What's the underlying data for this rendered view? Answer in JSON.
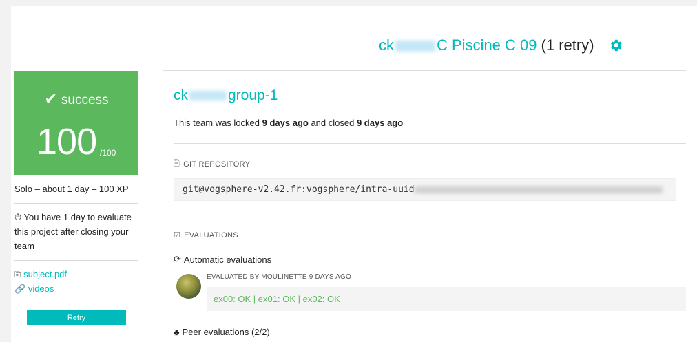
{
  "header": {
    "login_prefix": "ck",
    "project_name": "C Piscine C 09",
    "retry_text": "(1 retry)",
    "settings_icon": "gear-icon",
    "accent_color": "#00babc"
  },
  "score": {
    "status": "success",
    "mark": "100",
    "max": "/100",
    "color": "#5cb85c"
  },
  "sidebar": {
    "project_info": "Solo – about 1 day – 100 XP",
    "evaluation_note": "You have 1 day to evaluate this project after closing your team",
    "links": [
      {
        "label": "subject.pdf",
        "icon": "file-icon"
      },
      {
        "label": "videos",
        "icon": "link-icon"
      }
    ],
    "retry_button": "Retry"
  },
  "team": {
    "name_prefix": "ck",
    "name_suffix": "group-1",
    "lock_text_1": "This team was locked",
    "locked_ago": "9 days ago",
    "lock_text_2": "and closed",
    "closed_ago": "9 days ago"
  },
  "repository": {
    "label": "GIT REPOSITORY",
    "url": "git@vogsphere-v2.42.fr:vogsphere/intra-uuid"
  },
  "evaluations": {
    "label": "EVALUATIONS",
    "automatic_label": "Automatic evaluations",
    "evaluated_by": "EVALUATED BY MOULINETTE 9 DAYS AGO",
    "result": "ex00: OK | ex01: OK | ex02: OK",
    "peer_label": "Peer evaluations (2/2)"
  }
}
